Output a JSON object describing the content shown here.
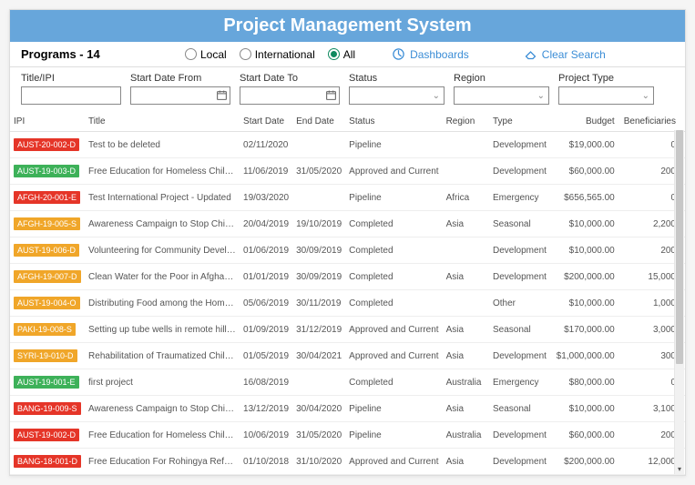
{
  "header": {
    "title": "Project Management System"
  },
  "toolbar": {
    "programs_label": "Programs - 14",
    "radios": {
      "local": "Local",
      "international": "International",
      "all": "All",
      "selected": "all"
    },
    "dashboards": "Dashboards",
    "clear_search": "Clear Search"
  },
  "filters": {
    "title_label": "Title/IPI",
    "start_from_label": "Start Date From",
    "start_to_label": "Start Date To",
    "status_label": "Status",
    "region_label": "Region",
    "project_type_label": "Project Type"
  },
  "columns": [
    "IPI",
    "Title",
    "Start Date",
    "End Date",
    "Status",
    "Region",
    "Type",
    "Budget",
    "Beneficiaries"
  ],
  "rows": [
    {
      "ipi": "AUST-20-002-D",
      "color": "c-red",
      "title": "Test to be deleted",
      "start": "02/11/2020",
      "end": "",
      "status": "Pipeline",
      "region": "",
      "type": "Development",
      "budget": "$19,000.00",
      "ben": "0"
    },
    {
      "ipi": "AUST-19-003-D",
      "color": "c-green",
      "title": "Free Education for Homeless Children",
      "start": "11/06/2019",
      "end": "31/05/2020",
      "status": "Approved and Current",
      "region": "",
      "type": "Development",
      "budget": "$60,000.00",
      "ben": "200"
    },
    {
      "ipi": "AFGH-20-001-E",
      "color": "c-red",
      "title": "Test International Project - Updated",
      "start": "19/03/2020",
      "end": "",
      "status": "Pipeline",
      "region": "Africa",
      "type": "Emergency",
      "budget": "$656,565.00",
      "ben": "0"
    },
    {
      "ipi": "AFGH-19-005-S",
      "color": "c-orange",
      "title": "Awareness Campaign to Stop Child Labor...",
      "start": "20/04/2019",
      "end": "19/10/2019",
      "status": "Completed",
      "region": "Asia",
      "type": "Seasonal",
      "budget": "$10,000.00",
      "ben": "2,200"
    },
    {
      "ipi": "AUST-19-006-D",
      "color": "c-orange",
      "title": "Volunteering for Community Development",
      "start": "01/06/2019",
      "end": "30/09/2019",
      "status": "Completed",
      "region": "",
      "type": "Development",
      "budget": "$10,000.00",
      "ben": "200"
    },
    {
      "ipi": "AFGH-19-007-D",
      "color": "c-orange",
      "title": "Clean Water for the Poor in Afghanistan",
      "start": "01/01/2019",
      "end": "30/09/2019",
      "status": "Completed",
      "region": "Asia",
      "type": "Development",
      "budget": "$200,000.00",
      "ben": "15,000"
    },
    {
      "ipi": "AUST-19-004-O",
      "color": "c-orange",
      "title": "Distributing Food among the Homeless",
      "start": "05/06/2019",
      "end": "30/11/2019",
      "status": "Completed",
      "region": "",
      "type": "Other",
      "budget": "$10,000.00",
      "ben": "1,000"
    },
    {
      "ipi": "PAKI-19-008-S",
      "color": "c-orange",
      "title": "Setting up tube wells in remote hilly area...",
      "start": "01/09/2019",
      "end": "31/12/2019",
      "status": "Approved and Current",
      "region": "Asia",
      "type": "Seasonal",
      "budget": "$170,000.00",
      "ben": "3,000"
    },
    {
      "ipi": "SYRI-19-010-D",
      "color": "c-orange",
      "title": "Rehabilitation of Traumatized Children of ...",
      "start": "01/05/2019",
      "end": "30/04/2021",
      "status": "Approved and Current",
      "region": "Asia",
      "type": "Development",
      "budget": "$1,000,000.00",
      "ben": "300"
    },
    {
      "ipi": "AUST-19-001-E",
      "color": "c-green",
      "title": "first project",
      "start": "16/08/2019",
      "end": "",
      "status": "Completed",
      "region": "Australia",
      "type": "Emergency",
      "budget": "$80,000.00",
      "ben": "0"
    },
    {
      "ipi": "BANG-19-009-S",
      "color": "c-red",
      "title": "Awareness Campaign to Stop Child Labor...",
      "start": "13/12/2019",
      "end": "30/04/2020",
      "status": "Pipeline",
      "region": "Asia",
      "type": "Seasonal",
      "budget": "$10,000.00",
      "ben": "3,100"
    },
    {
      "ipi": "AUST-19-002-D",
      "color": "c-red",
      "title": "Free Education for Homeless Children",
      "start": "10/06/2019",
      "end": "31/05/2020",
      "status": "Pipeline",
      "region": "Australia",
      "type": "Development",
      "budget": "$60,000.00",
      "ben": "200"
    },
    {
      "ipi": "BANG-18-001-D",
      "color": "c-red",
      "title": "Free Education For Rohingya Refugee Chi...",
      "start": "01/10/2018",
      "end": "31/10/2020",
      "status": "Approved and Current",
      "region": "Asia",
      "type": "Development",
      "budget": "$200,000.00",
      "ben": "12,000"
    }
  ]
}
